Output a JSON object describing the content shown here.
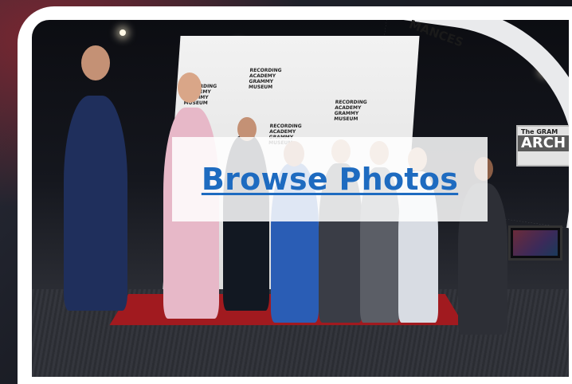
{
  "link": {
    "label": "Browse Photos"
  },
  "photo": {
    "backdrop_text": "GRAMMY MUSEUM",
    "backdrop_small_text": "RECORDING ACADEMY",
    "arch_text": "MANCES",
    "side_sign_top": "The GRAM",
    "side_sign_main": "ARCH"
  },
  "colors": {
    "link": "#1e6bc0",
    "frame": "#ffffff",
    "carpet": "#a11a1f"
  }
}
